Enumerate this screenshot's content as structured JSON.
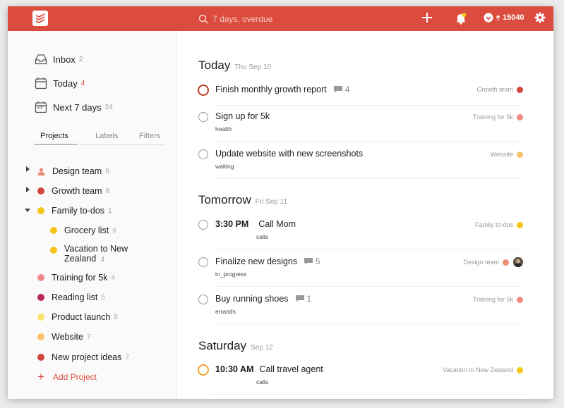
{
  "topbar": {
    "search_placeholder": "7 days, overdue",
    "karma_value": "15040",
    "colors": {
      "bar": "#db4c3f"
    }
  },
  "sidebar": {
    "nav": [
      {
        "label": "Inbox",
        "count": "2",
        "icon": "inbox-icon"
      },
      {
        "label": "Today",
        "count": "4",
        "icon": "calendar-icon"
      },
      {
        "label": "Next 7 days",
        "count": "24",
        "icon": "calendar-7-icon",
        "icon_text": "+7"
      }
    ],
    "tabs": [
      "Projects",
      "Labels",
      "Filters"
    ],
    "projects": [
      {
        "name": "Design team",
        "count": "8",
        "color": "#f08a75",
        "expandable": true,
        "shared": true
      },
      {
        "name": "Growth team",
        "count": "8",
        "color": "#d1453b",
        "expandable": true
      },
      {
        "name": "Family to-dos",
        "count": "1",
        "color": "#f5c518",
        "expanded": true
      },
      {
        "name": "Grocery list",
        "count": "6",
        "color": "#f5c518"
      },
      {
        "name": "Vacation to New Zealand",
        "count": "4",
        "color": "#f5c518"
      },
      {
        "name": "Training for 5k",
        "count": "4",
        "color": "#f08a88"
      },
      {
        "name": "Reading list",
        "count": "5",
        "color": "#b8255f"
      },
      {
        "name": "Product launch",
        "count": "8",
        "color": "#f9e46b"
      },
      {
        "name": "Website",
        "count": "7",
        "color": "#f6c26b"
      },
      {
        "name": "New project ideas",
        "count": "7",
        "color": "#d1453b"
      }
    ],
    "add_project_label": "Add Project"
  },
  "main": {
    "sections": [
      {
        "title": "Today",
        "date": "Thu Sep 10"
      },
      {
        "title": "Tomorrow",
        "date": "Fri Sep 11"
      },
      {
        "title": "Saturday",
        "date": "Sep 12"
      }
    ],
    "tasks": [
      {
        "title": "Finish monthly growth report",
        "comments": "4",
        "project": "Growth team",
        "project_color": "#d1453b",
        "priority": "p1"
      },
      {
        "title": "Sign up for 5k",
        "label": "health",
        "project": "Training for 5k",
        "project_color": "#f08a88"
      },
      {
        "title": "Update website with new screenshots",
        "label": "waiting",
        "project": "Website",
        "project_color": "#f6c26b"
      },
      {
        "time": "3:30 PM",
        "title": "Call Mom",
        "label": "calls",
        "project": "Family to-dos",
        "project_color": "#f5c518"
      },
      {
        "title": "Finalize new designs",
        "comments": "5",
        "label": "in_progress",
        "project": "Design team",
        "project_color": "#f08a75",
        "assignee": "avatar"
      },
      {
        "title": "Buy running shoes",
        "comments": "1",
        "label": "errands",
        "project": "Training for 5k",
        "project_color": "#f08a88"
      },
      {
        "time": "10:30 AM",
        "title": "Call travel agent",
        "label": "calls",
        "project": "Vacation to New Zealand",
        "project_color": "#f5c518",
        "priority": "p3"
      }
    ]
  }
}
